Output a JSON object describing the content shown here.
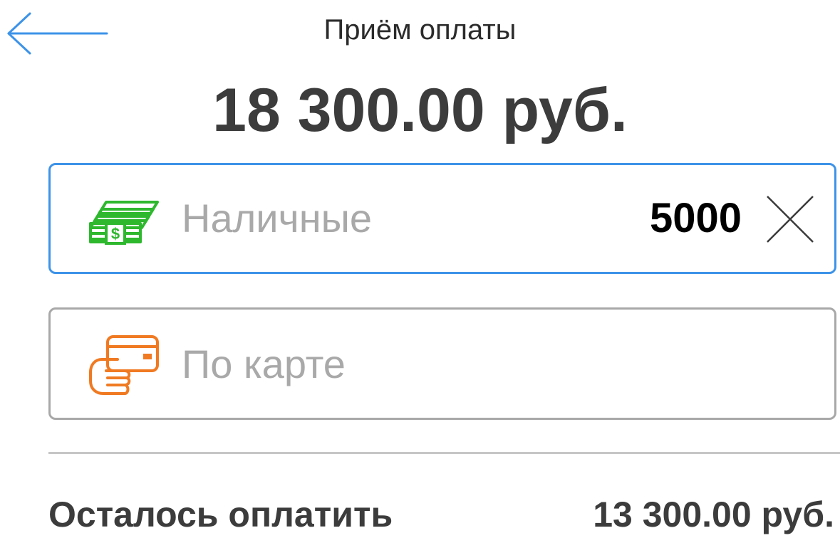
{
  "header": {
    "title": "Приём оплаты",
    "back_icon": "arrow-left-icon"
  },
  "total": {
    "amount": "18 300.00 руб."
  },
  "payment_methods": [
    {
      "label": "Наличные",
      "value": "5000",
      "icon": "cash-icon",
      "icon_color": "#2eb82e",
      "active": true
    },
    {
      "label": "По карте",
      "value": "",
      "icon": "card-hand-icon",
      "icon_color": "#f07a22",
      "active": false
    }
  ],
  "summary": {
    "remaining_label": "Осталось оплатить",
    "remaining_value": "13 300.00 руб."
  },
  "colors": {
    "accent": "#3d93e8",
    "border_inactive": "#a8a8a8",
    "text_dark": "#3c3c3c",
    "placeholder": "#a9a9a9"
  }
}
